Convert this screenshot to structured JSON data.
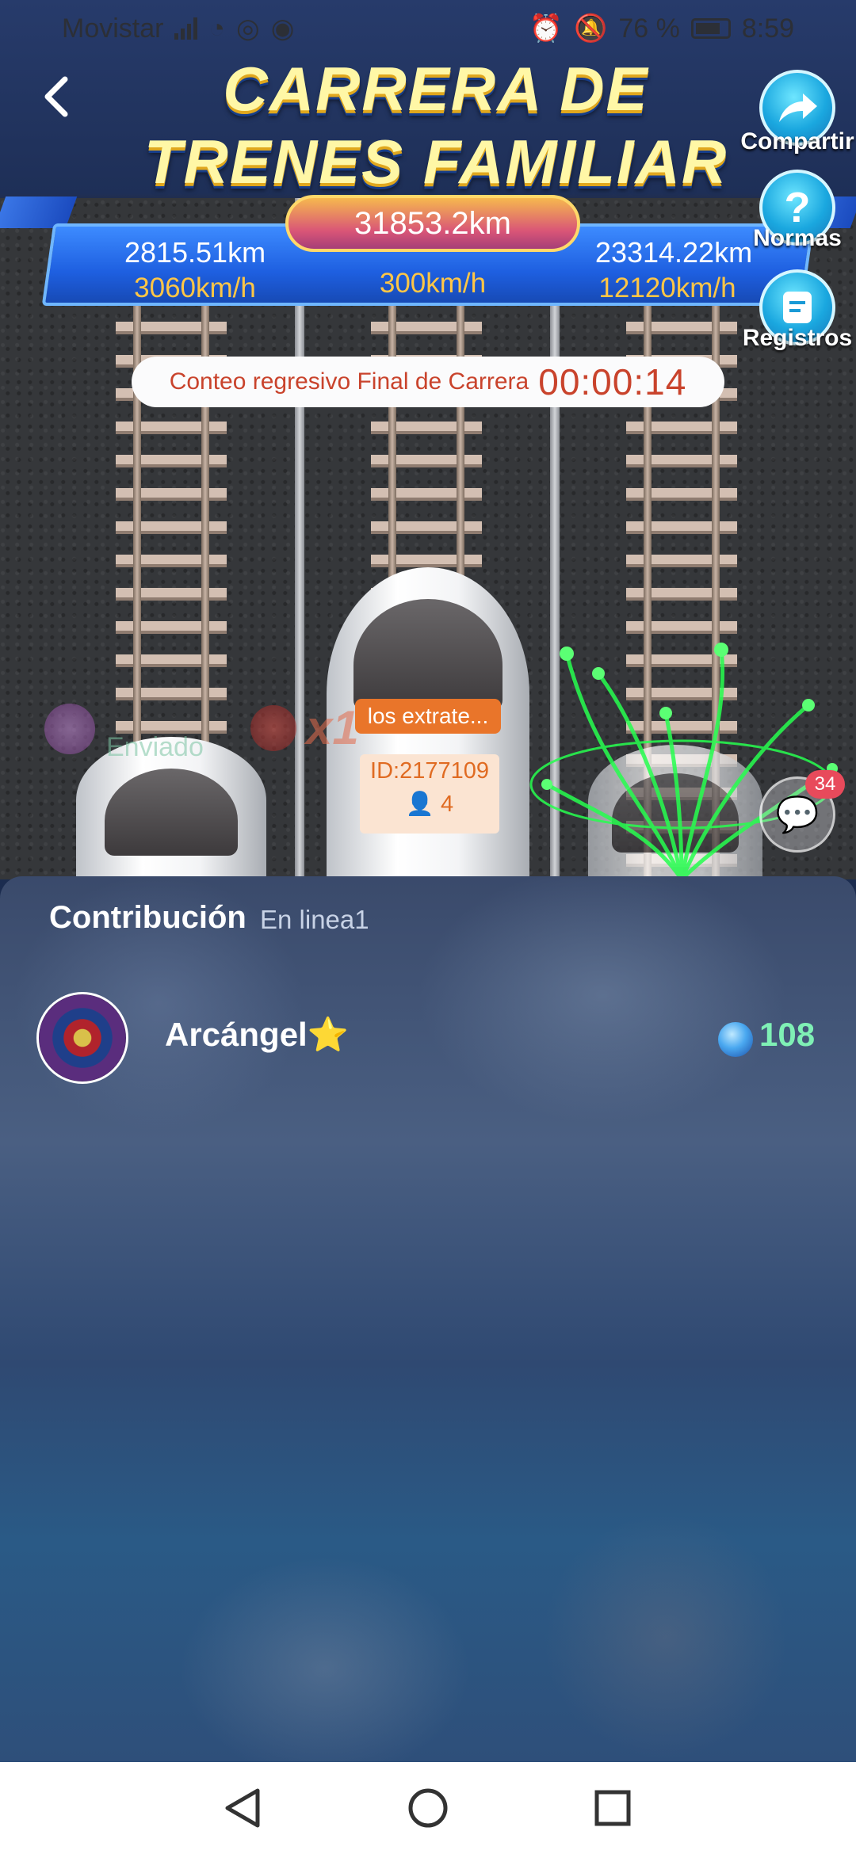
{
  "status_bar": {
    "carrier": "Movistar",
    "battery": "76 %",
    "time": "8:59"
  },
  "header": {
    "title_line1": "CARRERA DE",
    "title_line2": "TRENES FAMILIAR",
    "actions": [
      {
        "label": "Compartir",
        "icon": "share-icon"
      },
      {
        "label": "Normas",
        "icon": "help-icon"
      },
      {
        "label": "Registros",
        "icon": "records-icon"
      }
    ]
  },
  "race": {
    "total_distance": "31853.2km",
    "lanes": [
      {
        "distance": "2815.51km",
        "speed": "3060km/h"
      },
      {
        "distance": "",
        "speed": "300km/h"
      },
      {
        "distance": "23314.22km",
        "speed": "12120km/h"
      }
    ],
    "countdown_label": "Conteo regresivo Final de Carrera",
    "countdown_time": "00:00:14"
  },
  "train": {
    "name": "los extrate...",
    "id_label": "ID:2177109",
    "members": "4"
  },
  "gift_feed": {
    "text": "Enviado",
    "multiplier": "x1"
  },
  "chat": {
    "badge": "34"
  },
  "panel": {
    "title": "Contribución",
    "subtitle": "En linea1",
    "rows": [
      {
        "name": "Arcángel⭐",
        "amount": "108"
      }
    ]
  },
  "colors": {
    "accent_orange": "#e9752a",
    "countdown_red": "#c9432c",
    "speed_yellow": "#ffc646",
    "amount_green": "#7ff0b5"
  }
}
